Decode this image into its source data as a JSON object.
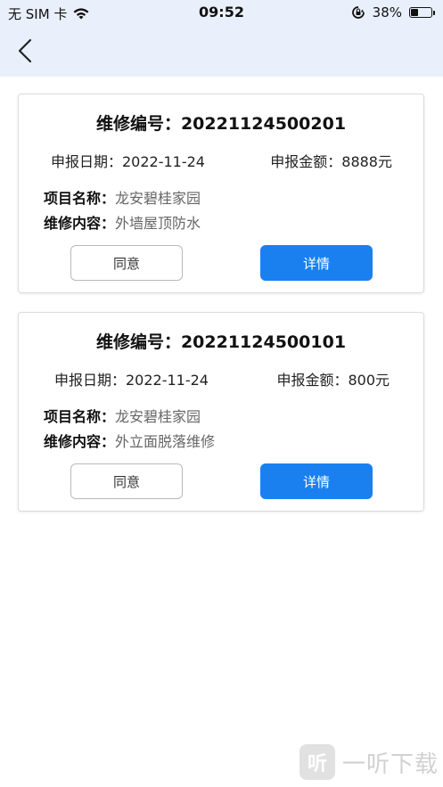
{
  "status_bar": {
    "carrier": "无 SIM 卡",
    "time": "09:52",
    "battery_percent": "38%",
    "battery_level": 0.38,
    "icons": [
      "wifi-icon",
      "orientation-lock-icon",
      "battery-icon"
    ]
  },
  "nav": {
    "back_icon": "chevron-left-icon"
  },
  "cards": [
    {
      "title": "维修编号：20221124500201",
      "date_text": "申报日期：2022-11-24",
      "amount_text": "申报金额：8888元",
      "project_label": "项目名称：",
      "project_value": "龙安碧桂家园",
      "content_label": "维修内容：",
      "content_value": "外墙屋顶防水",
      "agree_label": "同意",
      "detail_label": "详情"
    },
    {
      "title": "维修编号：20221124500101",
      "date_text": "申报日期：2022-11-24",
      "amount_text": "申报金额：800元",
      "project_label": "项目名称：",
      "project_value": "龙安碧桂家园",
      "content_label": "维修内容：",
      "content_value": "外立面脱落维修",
      "agree_label": "同意",
      "detail_label": "详情"
    }
  ],
  "watermark": {
    "logo": "听",
    "text": "一听下载"
  },
  "colors": {
    "header_bg": "#eaf0fb",
    "primary": "#1a80f0"
  }
}
